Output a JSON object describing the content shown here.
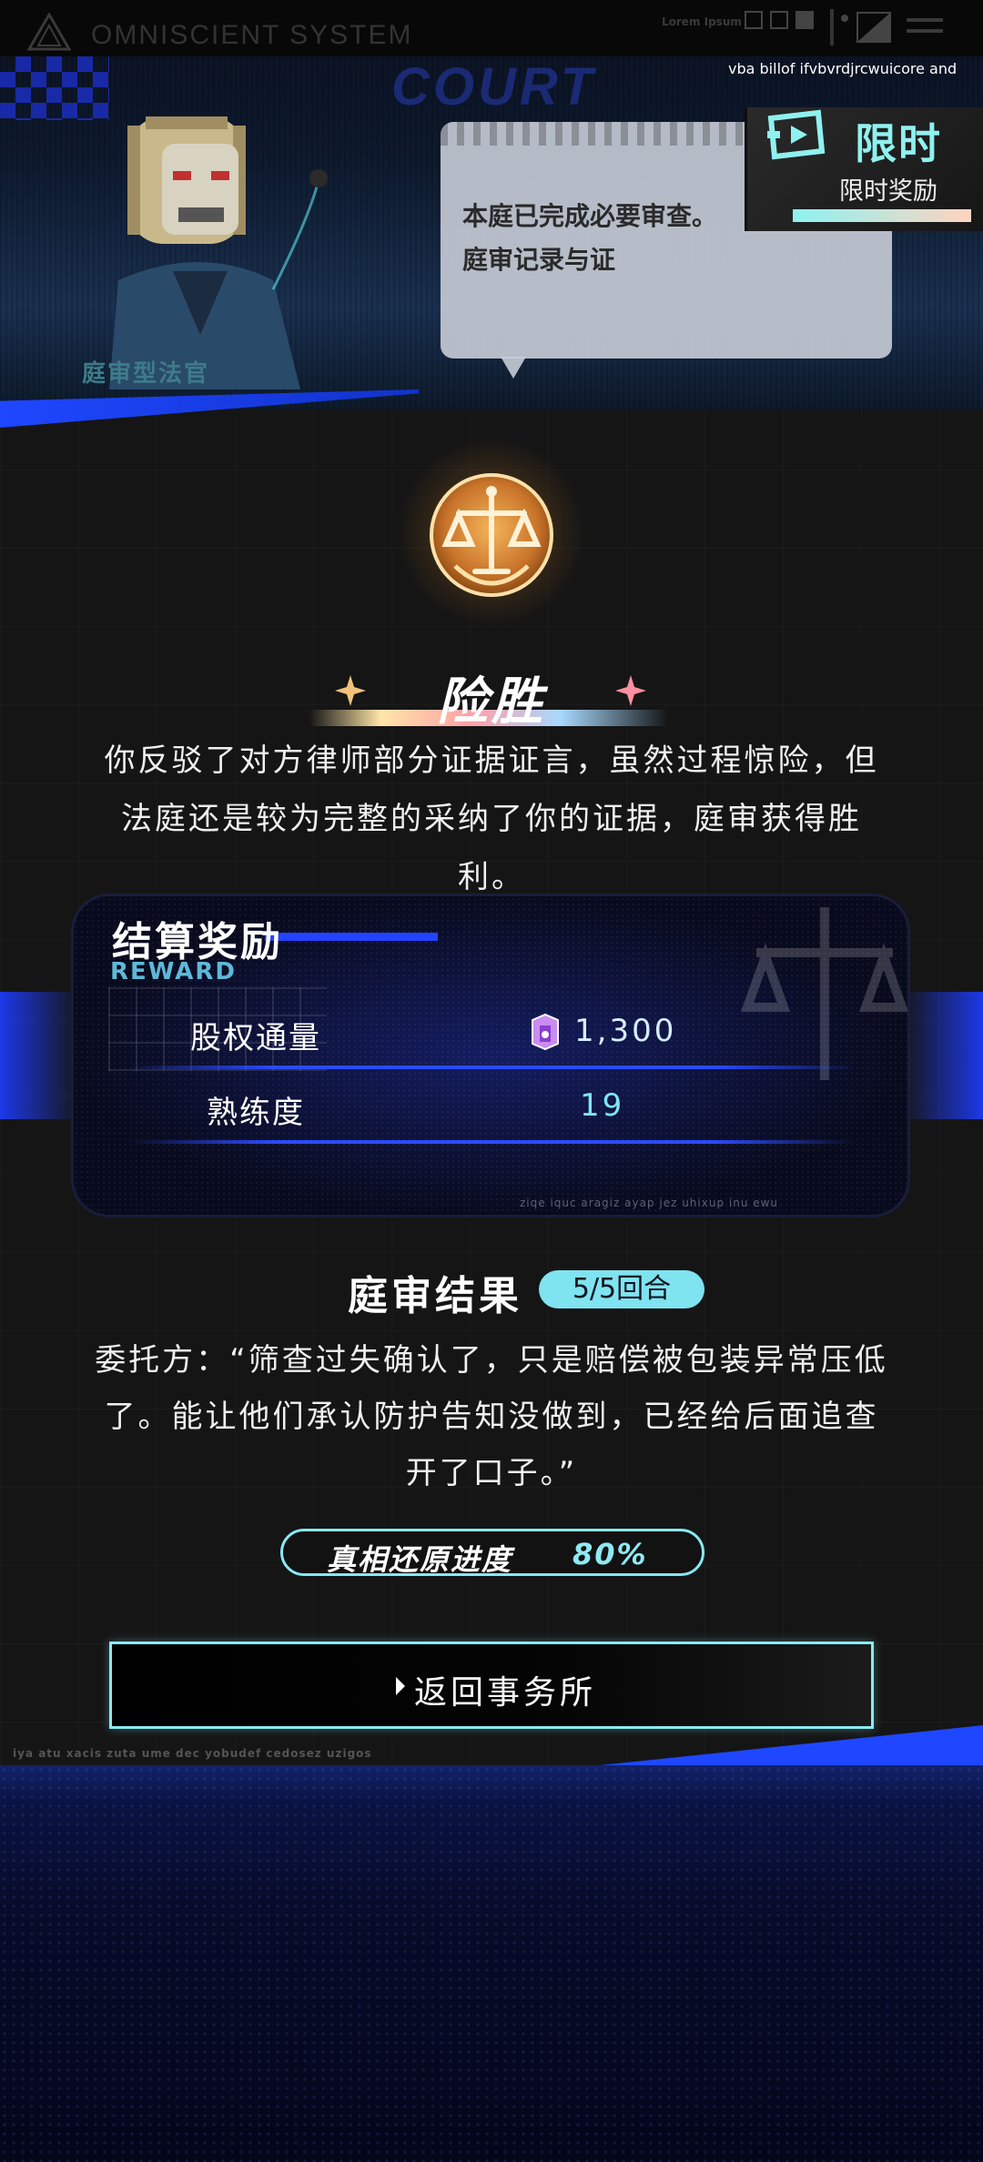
{
  "header": {
    "system_title": "OMNISCIENT SYSTEM",
    "lorem": "Lorem Ipsum",
    "tiny_code": "vba billof ifvbvrdjrcwuicore and"
  },
  "banner": {
    "background_word": "COURT",
    "judge_label": "庭审型法官",
    "bubble_text": "本庭已完成必要审查。\n庭审记录与证"
  },
  "limited": {
    "title": "限时",
    "subtitle": "限时奖励"
  },
  "verdict": {
    "title": "险胜",
    "description": "你反驳了对方律师部分证据证言，虽然过程惊险，但法庭还是较为完整的采纳了你的证据，庭审获得胜利。"
  },
  "reward": {
    "title": "结算奖励",
    "subtitle": "REWARD",
    "rows": [
      {
        "label": "股权通量",
        "value": "1,300",
        "icon": "equity-crystal-icon"
      },
      {
        "label": "熟练度",
        "value": "19"
      }
    ],
    "footer_code": "ziqe iquc aragiz ayap jez uhixup inu ewu"
  },
  "trial": {
    "title": "庭审结果",
    "rounds": "5/5回合",
    "quote": "委托方：“筛查过失确认了，只是赔偿被包装异常压低了。能让他们承认防护告知没做到，已经给后面追查开了口子。”",
    "progress_label": "真相还原进度",
    "progress_value": "80%"
  },
  "actions": {
    "return_label": "返回事务所"
  },
  "footer": {
    "code": "iya atu xacis zuta ume dec yobudef cedosez uzigos"
  },
  "colors": {
    "accent_cyan": "#8aeaf2",
    "accent_blue": "#1f47ff",
    "emblem_gold": "#f0a040"
  }
}
